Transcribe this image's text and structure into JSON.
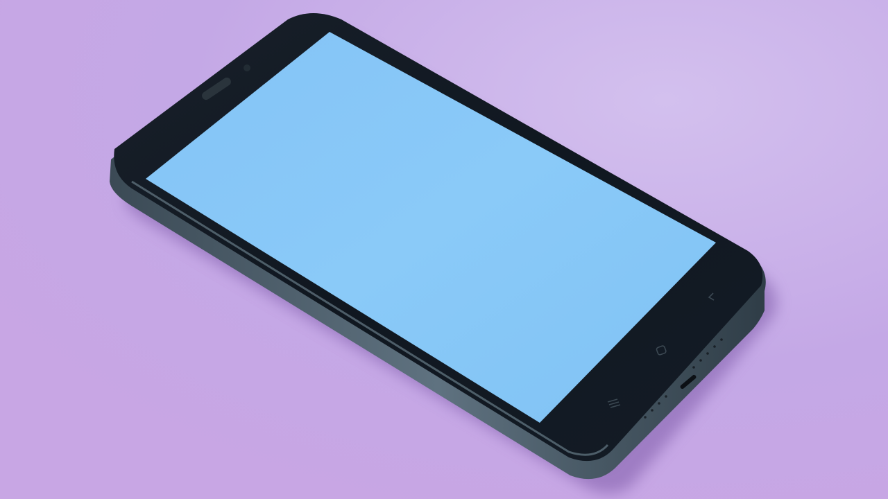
{
  "scene": {
    "subject": "smartphone",
    "colors": {
      "background": "#c4a8e6",
      "background_light": "#d2bdee",
      "phone_frame": "#1d2a33",
      "phone_body": "#121820",
      "screen": "#86c6f6",
      "screen_highlight": "#9ad2f8",
      "metal_rim": "#4a5a66"
    },
    "nav_icons": [
      "back-icon",
      "home-icon",
      "menu-icon"
    ]
  }
}
